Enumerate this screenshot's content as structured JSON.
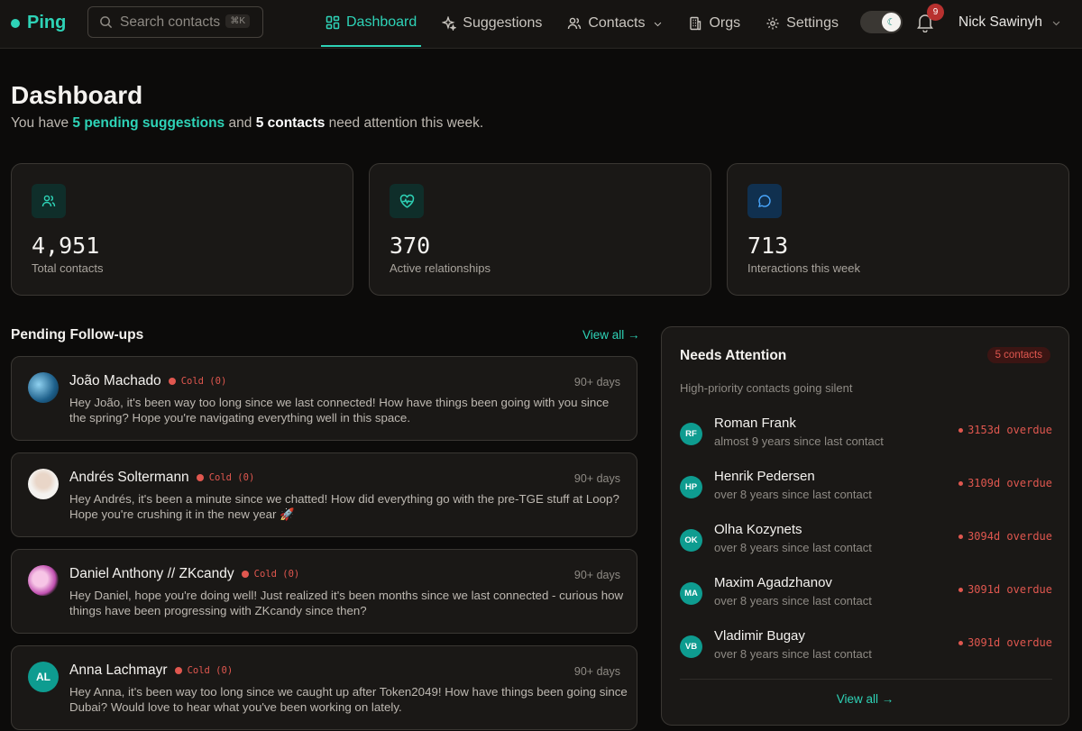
{
  "app": {
    "name": "Ping"
  },
  "search": {
    "placeholder": "Search contacts",
    "shortcut": "⌘K"
  },
  "nav": {
    "items": [
      {
        "label": "Dashboard",
        "icon": "grid-icon",
        "active": true
      },
      {
        "label": "Suggestions",
        "icon": "sparkle-icon"
      },
      {
        "label": "Contacts",
        "icon": "users-icon"
      },
      {
        "label": "Orgs",
        "icon": "building-icon"
      },
      {
        "label": "Settings",
        "icon": "gear-icon"
      }
    ],
    "notifications": "9",
    "user": "Nick Sawinyh"
  },
  "header": {
    "title": "Dashboard",
    "sub_pre": "You have",
    "sub_suggestions": "5 pending suggestions",
    "sub_mid": "and",
    "sub_contacts": "5 contacts",
    "sub_post": "need attention this week."
  },
  "stats": [
    {
      "value": "4,951",
      "label": "Total contacts",
      "icon": "users-icon",
      "color": "#2ed3b7"
    },
    {
      "value": "370",
      "label": "Active relationships",
      "icon": "heart-pulse-icon",
      "color": "#2ed3b7"
    },
    {
      "value": "713",
      "label": "Interactions this week",
      "icon": "chat-bubble-icon",
      "color": "#4aa8ff"
    }
  ],
  "followups": {
    "title": "Pending Follow-ups",
    "view_all": "View all →",
    "items": [
      {
        "name": "João Machado",
        "status": "Cold (0)",
        "days": "90+ days",
        "avatar": "photo",
        "message": "Hey João, it's been way too long since we last connected! How have things been going with you since the spring? Hope you're navigating everything well in this space."
      },
      {
        "name": "Andrés Soltermann",
        "status": "Cold (0)",
        "days": "90+ days",
        "avatar": "photo",
        "message": "Hey Andrés, it's been a minute since we chatted! How did everything go with the pre-TGE stuff at Loop? Hope you're crushing it in the new year 🚀"
      },
      {
        "name": "Daniel Anthony // ZKcandy",
        "status": "Cold (0)",
        "days": "90+ days",
        "avatar": "photo",
        "message": "Hey Daniel, hope you're doing well! Just realized it's been months since we last connected - curious how things have been progressing with ZKcandy since then?"
      },
      {
        "name": "Anna Lachmayr",
        "status": "Cold (0)",
        "days": "90+ days",
        "avatar": "AL",
        "message": "Hey Anna, it's been way too long since we caught up after Token2049! How have things been going since Dubai? Would love to hear what you've been working on lately."
      }
    ]
  },
  "attention": {
    "title": "Needs Attention",
    "pill": "5 contacts",
    "subtitle": "High-priority contacts going silent",
    "view_all": "View all →",
    "items": [
      {
        "initials": "RF",
        "name": "Roman Frank",
        "since": "almost 9 years since last contact",
        "overdue": "3153d overdue"
      },
      {
        "initials": "HP",
        "name": "Henrik Pedersen",
        "since": "over 8 years since last contact",
        "overdue": "3109d overdue"
      },
      {
        "initials": "OK",
        "name": "Olha Kozynets",
        "since": "over 8 years since last contact",
        "overdue": "3094d overdue"
      },
      {
        "initials": "MA",
        "name": "Maxim Agadzhanov",
        "since": "over 8 years since last contact",
        "overdue": "3091d overdue"
      },
      {
        "initials": "VB",
        "name": "Vladimir Bugay",
        "since": "over 8 years since last contact",
        "overdue": "3091d overdue"
      }
    ]
  }
}
